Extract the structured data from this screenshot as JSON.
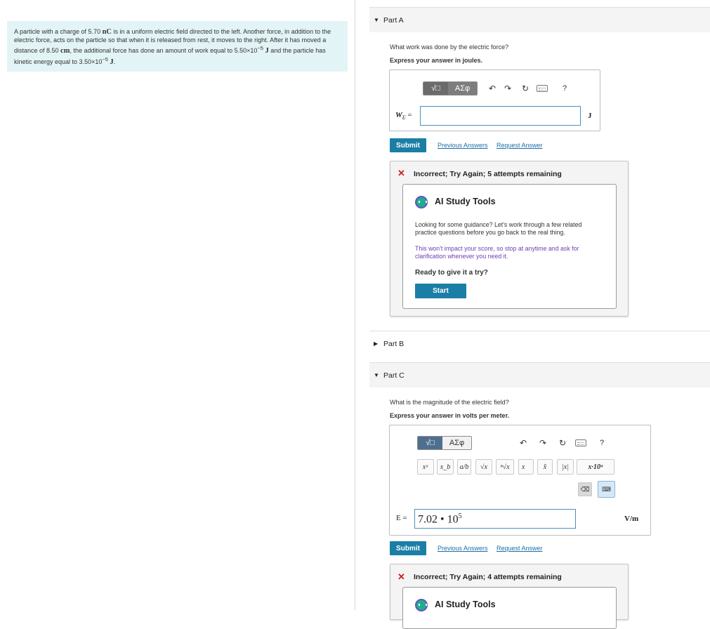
{
  "problem": {
    "seg1": "A particle with a charge of 5.70 ",
    "charge_unit": "nC",
    "seg2": " is in a uniform electric field directed to the left. Another force, in addition to the electric force, acts on the particle so that when it is released from rest, it moves to the right. After it has moved a distance of 8.50 ",
    "dist_unit": "cm",
    "seg3": ", the additional force has done an amount of work equal to 5.50×10",
    "exp1": "−5",
    "unit_j": "J",
    "seg4": " and the particle has kinetic energy equal to 3.50×10",
    "exp2": "−5",
    "end": "."
  },
  "partA": {
    "title": "Part A",
    "question": "What work was done by the electric force?",
    "instruction": "Express your answer in joules.",
    "toolbar": {
      "templates": "√□",
      "greek": "ΑΣφ",
      "undo": "↶",
      "redo": "↷",
      "reset": "↻",
      "help": "?"
    },
    "label_main": "W",
    "label_sub": "E",
    "label_eq": " =",
    "value": "",
    "unit": "J",
    "submit": "Submit",
    "prev": "Previous Answers",
    "request": "Request Answer",
    "feedback": "Incorrect; Try Again; 5 attempts remaining",
    "ai": {
      "title": "AI Study Tools",
      "p1": "Looking for some guidance? Let's work through a few related practice questions before you go back to the real thing.",
      "p2": "This won't impact your score, so stop at anytime and ask for clarification whenever you need it.",
      "p3": "Ready to give it a try?",
      "start": "Start"
    }
  },
  "partB": {
    "title": "Part B"
  },
  "partC": {
    "title": "Part C",
    "question": "What is the magnitude of the electric field?",
    "instruction": "Express your answer in volts per meter.",
    "toolbar": {
      "templates": "√□",
      "greek": "ΑΣφ",
      "undo": "↶",
      "redo": "↷",
      "reset": "↻",
      "help": "?"
    },
    "symbols": [
      "xᵃ",
      "x_b",
      "a/b",
      "√x",
      "ⁿ√x",
      "x⃗",
      "x̂",
      "|x|",
      "x·10ⁿ"
    ],
    "label": "E =",
    "value_mantissa": "7.02 • 10",
    "value_exp": "5",
    "unit": "V/m",
    "submit": "Submit",
    "prev": "Previous Answers",
    "request": "Request Answer",
    "feedback": "Incorrect; Try Again; 4 attempts remaining",
    "ai": {
      "title": "AI Study Tools"
    }
  },
  "colors": {
    "accent": "#1b7ea6",
    "error": "#cc1f1f",
    "problem_bg": "#e3f4f6",
    "purple_text": "#6a3fb5"
  }
}
